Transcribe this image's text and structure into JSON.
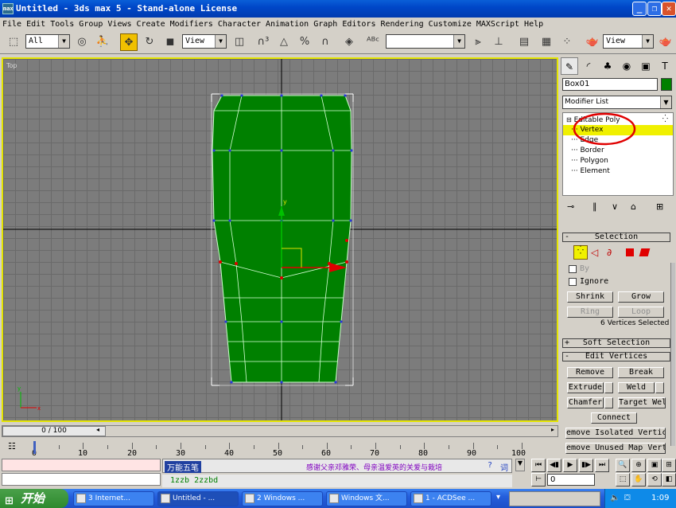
{
  "window": {
    "title": "Untitled - 3ds max 5 - Stand-alone License",
    "app_icon": "3ds-max-icon",
    "controls": {
      "minimize": "_",
      "maximize": "❐",
      "close": "✕"
    }
  },
  "menu": [
    "File",
    "Edit",
    "Tools",
    "Group",
    "Views",
    "Create",
    "Modifiers",
    "Character",
    "Animation",
    "Graph Editors",
    "Rendering",
    "Customize",
    "MAXScript",
    "Help"
  ],
  "toolbar": {
    "selection_filter": "All",
    "ref_coord": "View",
    "named_selection": "",
    "render_view": "View"
  },
  "viewport": {
    "label": "Top",
    "active_color": "#e4e400",
    "mesh_color": "#008000"
  },
  "panel": {
    "object_name": "Box01",
    "object_color": "#008000",
    "modifier_list": "Modifier List",
    "stack": [
      {
        "label": "Editable Poly",
        "indent": 0,
        "selected": false
      },
      {
        "label": "Vertex",
        "indent": 1,
        "selected": true
      },
      {
        "label": "Edge",
        "indent": 1,
        "selected": false
      },
      {
        "label": "Border",
        "indent": 1,
        "selected": false
      },
      {
        "label": "Polygon",
        "indent": 1,
        "selected": false
      },
      {
        "label": "Element",
        "indent": 1,
        "selected": false
      }
    ],
    "selection": {
      "title": "Selection",
      "by_label": "By",
      "ignore_label": "Ignore",
      "shrink": "Shrink",
      "grow": "Grow",
      "ring": "Ring",
      "loop": "Loop",
      "status": "6 Vertices Selected"
    },
    "soft_selection": {
      "title": "Soft Selection",
      "toggle": "+"
    },
    "edit_vertices": {
      "title": "Edit Vertices",
      "toggle": "-",
      "remove": "Remove",
      "break": "Break",
      "extrude": "Extrude",
      "weld": "Weld",
      "chamfer": "Chamfer",
      "target_weld": "Target Weld",
      "connect": "Connect",
      "remove_isolated": "emove Isolated Vertic",
      "remove_unused": "emove Unused Map Vert"
    }
  },
  "timeline": {
    "frame_display": "0 / 100",
    "ruler_labels": [
      "0",
      "10",
      "20",
      "30",
      "40",
      "50",
      "60",
      "70",
      "80",
      "90",
      "100"
    ]
  },
  "status": {
    "ime_name": "万能五笔",
    "message": "感谢父亲邓雅荣、母亲温爱英的关爱与栽培",
    "ime_help": "?",
    "ime_word": "词",
    "input_code": "1zzb 2zzbd",
    "frame_field": "0"
  },
  "taskbar": {
    "start": "开始",
    "tasks": [
      "3 Internet...",
      "Untitled - ...",
      "2 Windows ...",
      "Windows 文...",
      "1 - ACDSee ..."
    ],
    "clock": "1:09"
  }
}
